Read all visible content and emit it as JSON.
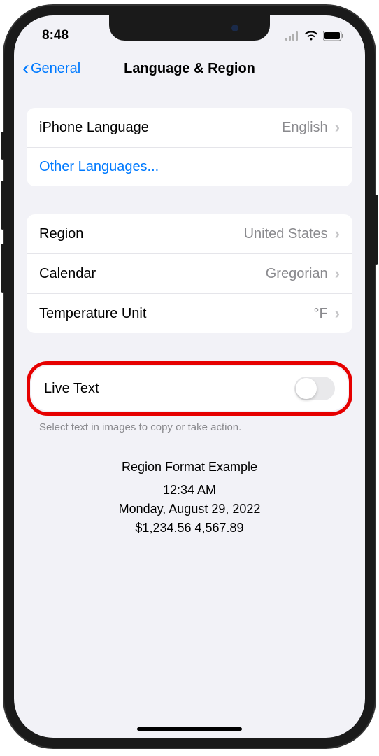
{
  "statusBar": {
    "time": "8:48"
  },
  "nav": {
    "backLabel": "General",
    "title": "Language & Region"
  },
  "group1": {
    "row1": {
      "label": "iPhone Language",
      "value": "English"
    },
    "row2": {
      "label": "Other Languages..."
    }
  },
  "group2": {
    "row1": {
      "label": "Region",
      "value": "United States"
    },
    "row2": {
      "label": "Calendar",
      "value": "Gregorian"
    },
    "row3": {
      "label": "Temperature Unit",
      "value": "°F"
    }
  },
  "group3": {
    "row1": {
      "label": "Live Text"
    },
    "footer": "Select text in images to copy or take action."
  },
  "example": {
    "title": "Region Format Example",
    "time": "12:34 AM",
    "date": "Monday, August 29, 2022",
    "numbers": "$1,234.56   4,567.89"
  }
}
